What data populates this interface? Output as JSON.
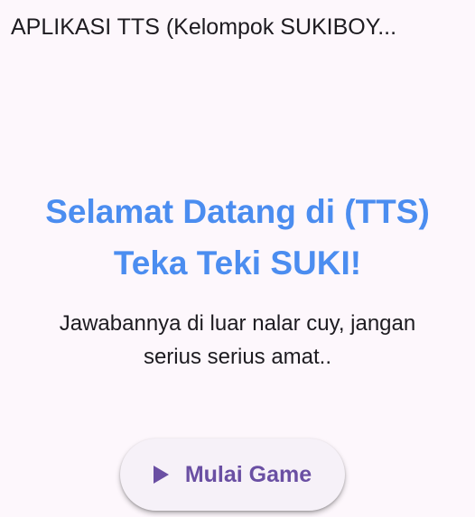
{
  "appbar": {
    "title": "APLIKASI TTS (Kelompok SUKIBOY..."
  },
  "welcome": {
    "headline_line1": "Selamat Datang di (TTS)",
    "headline_line2": "Teka Teki SUKI!",
    "subtitle_line1": "Jawabannya di luar nalar cuy, jangan",
    "subtitle_line2": "serius serius amat.."
  },
  "start_button": {
    "label": "Mulai Game",
    "icon": "play-icon"
  },
  "colors": {
    "background": "#fdf7fc",
    "headline": "#4b8df0",
    "button_text": "#6a4fa3"
  }
}
